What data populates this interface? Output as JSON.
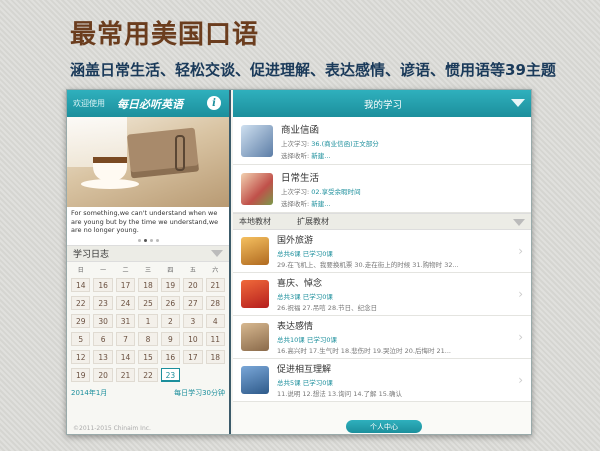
{
  "promo": {
    "title": "最常用美国口语",
    "subtitle": "涵盖日常生活、轻松交谈、促进理解、表达感情、谚语、惯用语等39主题"
  },
  "left": {
    "welcome": "欢迎使用",
    "logo": "每日必听英语",
    "info_icon": "i",
    "quote": "For something,we can't understand when we are young but by the time we understand,we are no longer young.",
    "carousel_dots": 4,
    "carousel_active": 1,
    "log_title": "学习日志",
    "weekdays": [
      "日",
      "一",
      "二",
      "三",
      "四",
      "五",
      "六"
    ],
    "calendar": [
      [
        "14",
        "16",
        "17",
        "18",
        "19",
        "20",
        "21"
      ],
      [
        "22",
        "23",
        "24",
        "25",
        "26",
        "27",
        "28"
      ],
      [
        "29",
        "30",
        "31",
        "1",
        "2",
        "3",
        "4"
      ],
      [
        "5",
        "6",
        "7",
        "8",
        "9",
        "10",
        "11"
      ],
      [
        "12",
        "13",
        "14",
        "15",
        "16",
        "17",
        "18"
      ],
      [
        "19",
        "20",
        "21",
        "22",
        "23",
        "",
        ""
      ]
    ],
    "today_row": 5,
    "today_col": 4,
    "month": "2014年1月",
    "daily_study": "每日学习30分钟",
    "copyright": "©2011-2015 Chinaim Inc."
  },
  "right": {
    "title": "我的学习",
    "items": [
      {
        "name": "商业信函",
        "last_label": "上次学习:",
        "last_value": "36.(商业信函)正文部分",
        "collect_label": "选择收听:",
        "collect_value": "新建..."
      },
      {
        "name": "日常生活",
        "last_label": "上次学习:",
        "last_value": "02.享受余暇时间",
        "collect_label": "选择收听:",
        "collect_value": "新建..."
      }
    ],
    "tabs": [
      "本地教材",
      "扩展教材"
    ],
    "courses": [
      {
        "name": "国外旅游",
        "meta": "总共6课 已学习0课",
        "last": "29.在飞机上、我要换机票 30.走在街上的时候 31.购物时 32..."
      },
      {
        "name": "喜庆、悼念",
        "meta": "总共3课 已学习0课",
        "last": "26.祝福 27.吊唁 28.节日、纪念日"
      },
      {
        "name": "表达感情",
        "meta": "总共10课 已学习0课",
        "last": "16.高兴时 17.生气时 18.悲伤时 19.哭泣时 20.后悔时 21..."
      },
      {
        "name": "促进相互理解",
        "meta": "总共5课 已学习0课",
        "last": "11.说明 12.想法 13.询问 14.了解 15.确认"
      }
    ],
    "personal_center": "个人中心"
  }
}
